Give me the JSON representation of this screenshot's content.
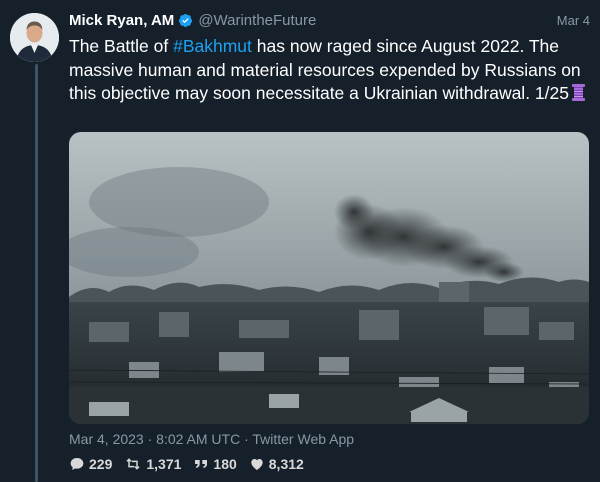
{
  "author": {
    "name": "Mick Ryan, AM",
    "handle": "@WarintheFuture",
    "date": "Mar 4"
  },
  "tweet": {
    "text_before": "The Battle of ",
    "hashtag": "#Bakhmut",
    "text_after": "  has now raged since August 2022. The massive human and material resources expended by Russians on this objective may soon necessitate a Ukrainian withdrawal. 1/25",
    "emoji": "thread-spool-icon"
  },
  "meta": {
    "timestamp": "Mar 4, 2023 · 8:02 AM UTC · Twitter Web App"
  },
  "metrics": {
    "replies": "229",
    "retweets": "1,371",
    "quotes": "180",
    "likes": "8,312"
  },
  "colors": {
    "background": "#15202b",
    "accent": "#1da1f2",
    "muted": "#8899a6"
  }
}
